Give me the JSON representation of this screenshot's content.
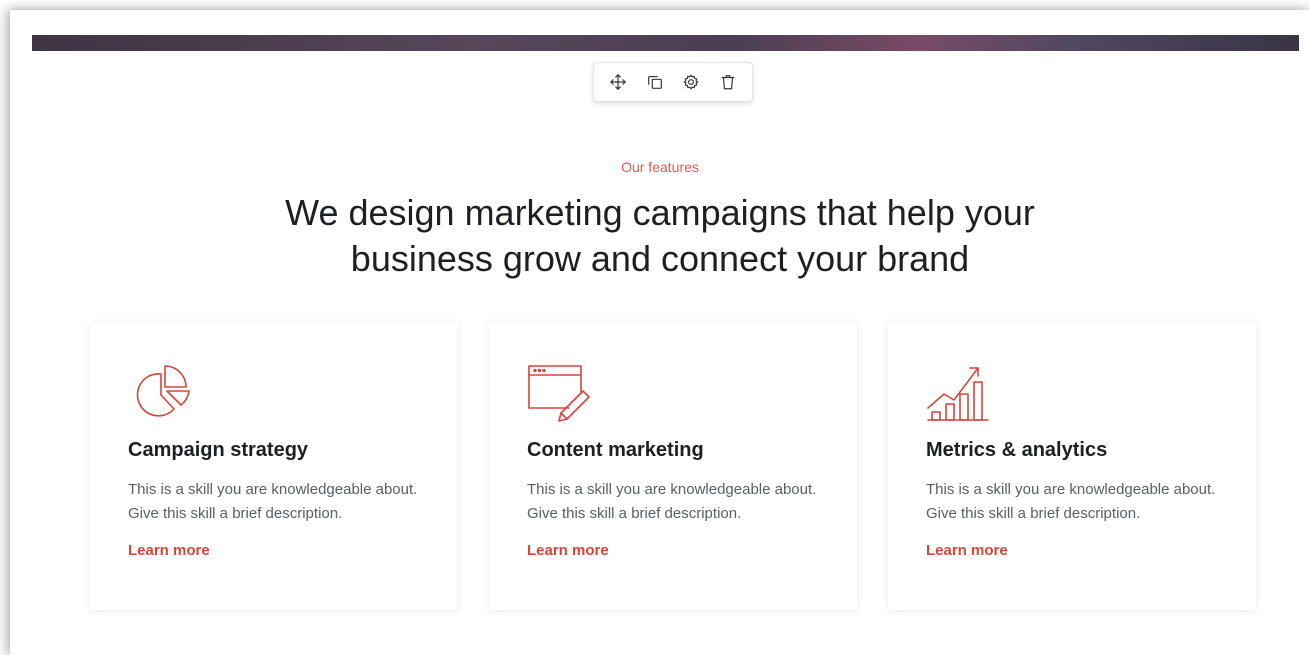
{
  "toolbar": {
    "buttons": [
      {
        "icon": "move-icon"
      },
      {
        "icon": "duplicate-icon"
      },
      {
        "icon": "gear-icon"
      },
      {
        "icon": "trash-icon"
      }
    ]
  },
  "section": {
    "eyebrow": "Our features",
    "headline": "We design marketing campaigns that help your business grow and connect your brand"
  },
  "cards": [
    {
      "icon": "pie-chart-icon",
      "title": "Campaign strategy",
      "description": "This is a skill you are knowledgeable about. Give this skill a brief description.",
      "link": "Learn more"
    },
    {
      "icon": "browser-pencil-icon",
      "title": "Content marketing",
      "description": "This is a skill you are knowledgeable about. Give this skill a brief description.",
      "link": "Learn more"
    },
    {
      "icon": "growth-chart-icon",
      "title": "Metrics & analytics",
      "description": "This is a skill you are knowledgeable about. Give this skill a brief description.",
      "link": "Learn more"
    }
  ],
  "colors": {
    "accent": "#d4463a",
    "eyebrow": "#d95c4f",
    "heading": "#1e1f24",
    "body": "#5a5d66"
  }
}
